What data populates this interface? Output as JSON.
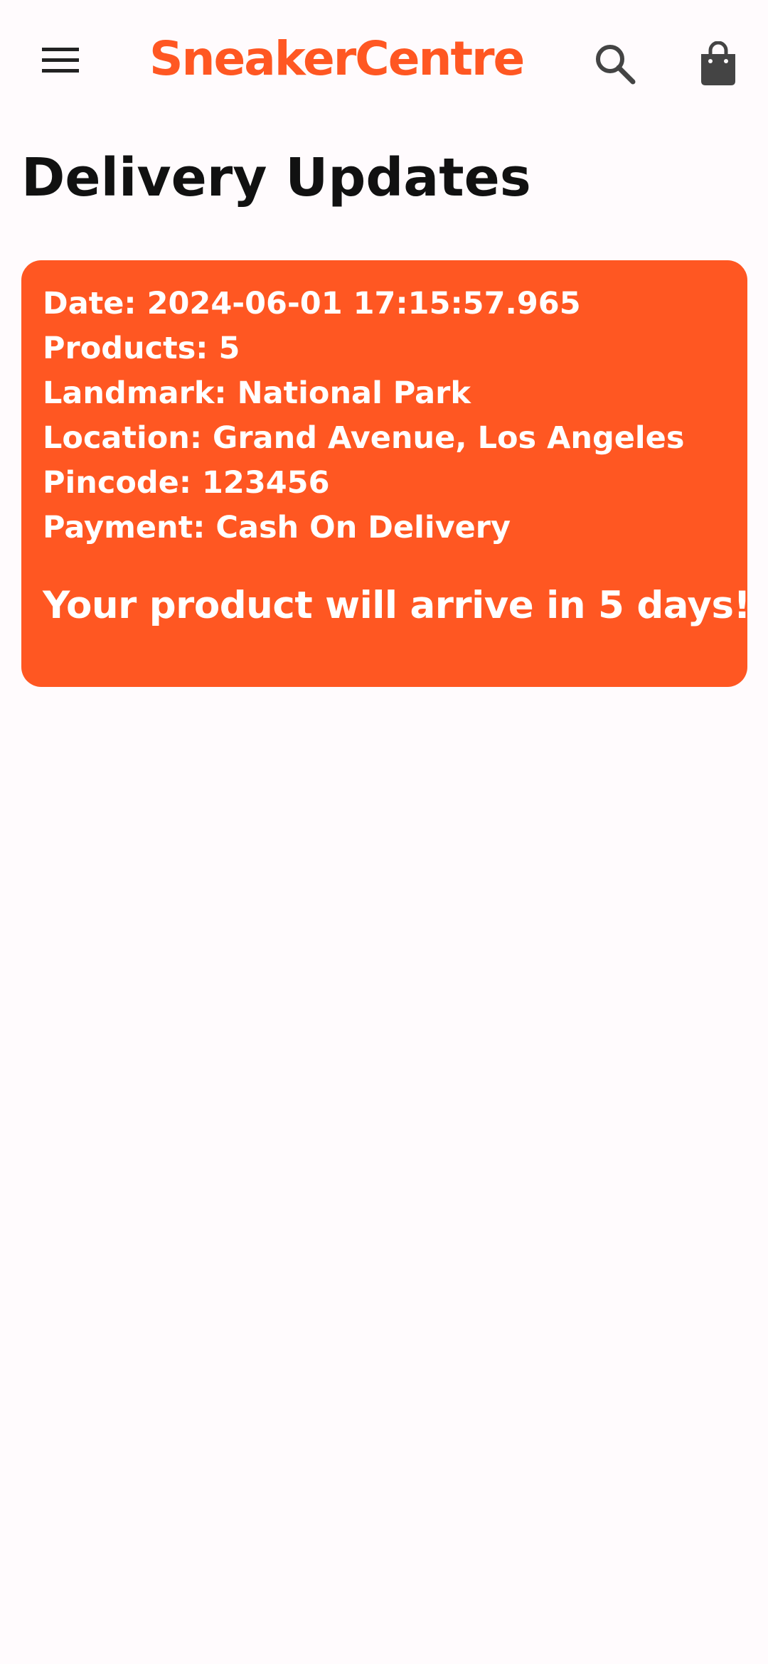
{
  "app_bar": {
    "brand": "SneakerCentre",
    "menu_icon": "menu-icon",
    "search_icon": "search-icon",
    "bag_icon": "shopping-bag-icon"
  },
  "page": {
    "title": "Delivery Updates"
  },
  "delivery": {
    "date": "Date: 2024-06-01 17:15:57.965",
    "products": "Products: 5",
    "landmark": "Landmark: National Park",
    "location": "Location: Grand Avenue, Los Angeles",
    "pincode": "Pincode: 123456",
    "payment": "Payment: Cash On Delivery",
    "arrival_message": "Your product will arrive in 5 days!"
  },
  "colors": {
    "accent": "#ff5722",
    "background": "#fffbfd",
    "icon": "#444444"
  }
}
